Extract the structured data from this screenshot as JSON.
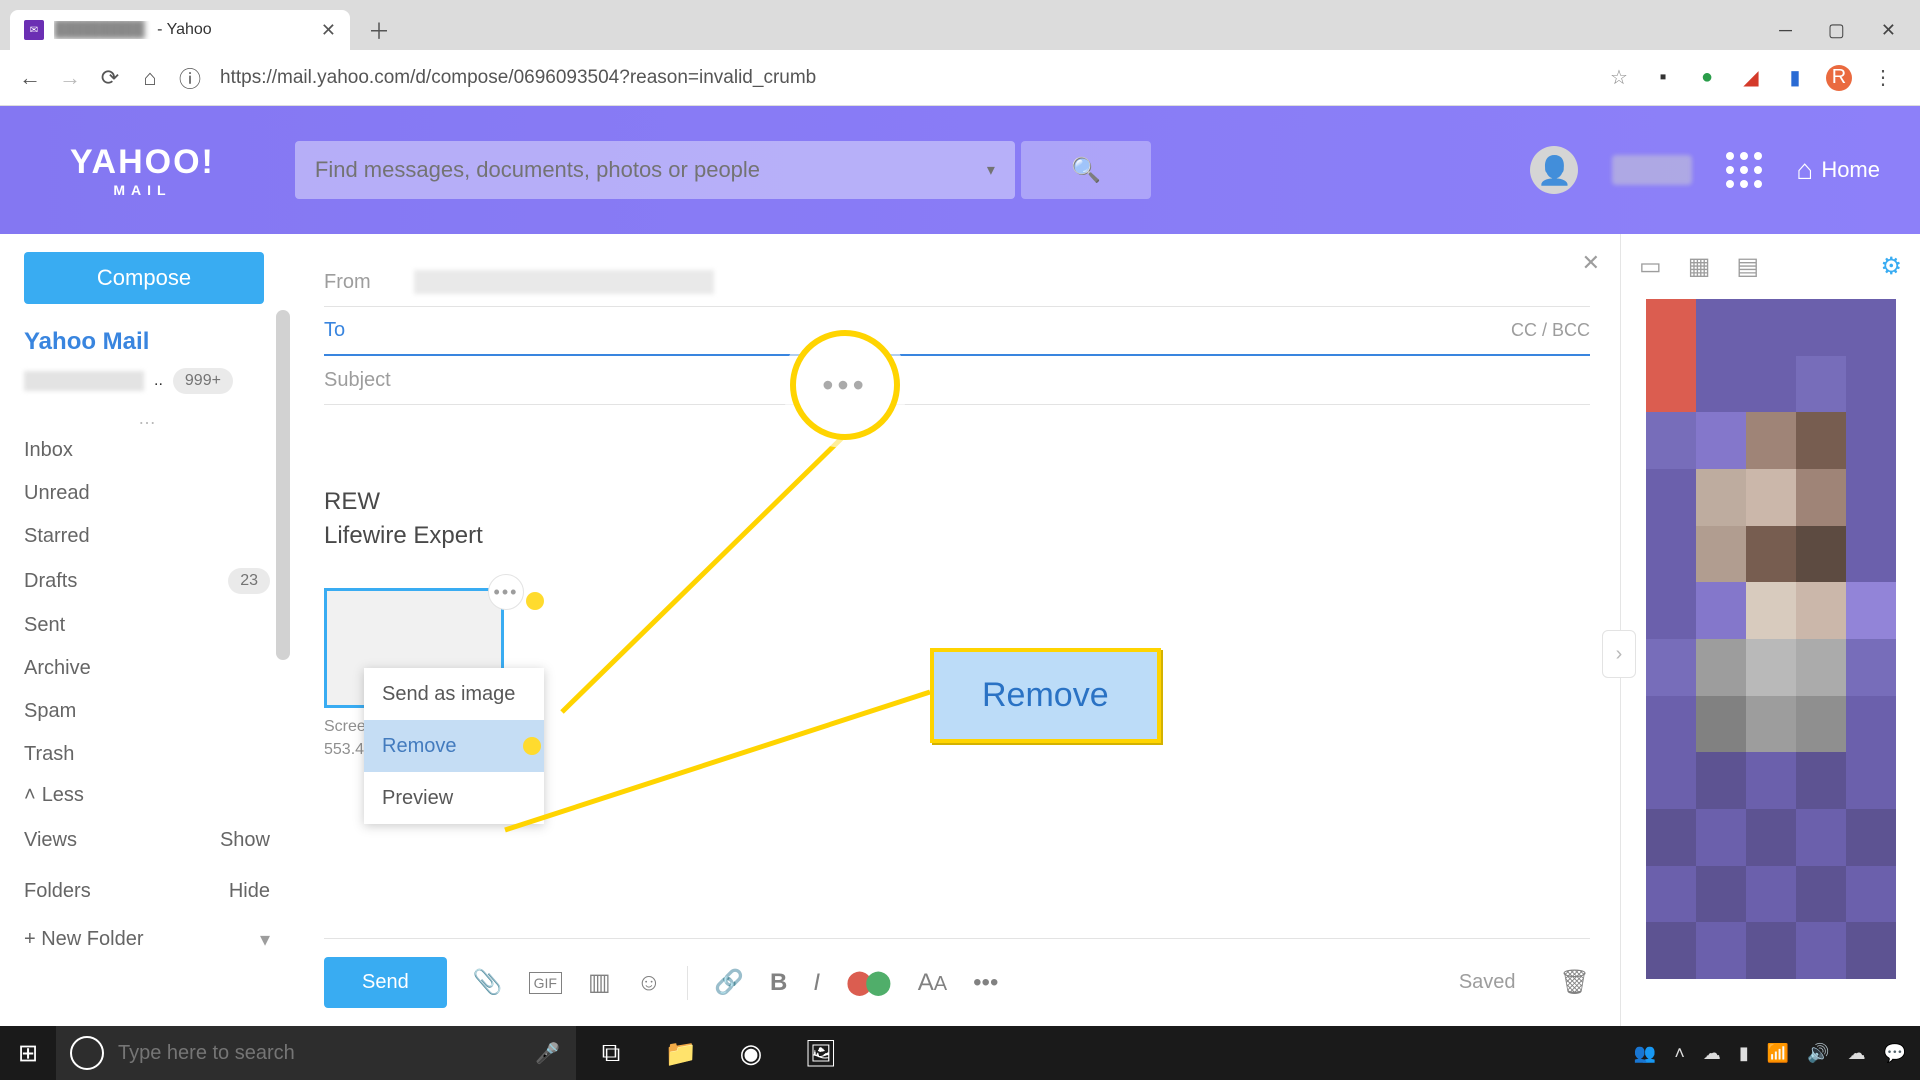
{
  "browser": {
    "tab_title_suffix": " - Yahoo",
    "url": "https://mail.yahoo.com/d/compose/0696093504?reason=invalid_crumb",
    "avatar_letter": "R"
  },
  "yahoo_header": {
    "logo_top": "YAHOO!",
    "logo_sub": "MAIL",
    "search_placeholder": "Find messages, documents, photos or people",
    "home_label": "Home"
  },
  "sidebar": {
    "compose": "Compose",
    "section_title": "Yahoo Mail",
    "unread_badge": "999+",
    "folders": [
      {
        "label": "Inbox"
      },
      {
        "label": "Unread"
      },
      {
        "label": "Starred"
      },
      {
        "label": "Drafts",
        "badge": "23"
      },
      {
        "label": "Sent"
      },
      {
        "label": "Archive"
      },
      {
        "label": "Spam"
      },
      {
        "label": "Trash"
      }
    ],
    "less": "Less",
    "views": {
      "label": "Views",
      "action": "Show"
    },
    "folders_section": {
      "label": "Folders",
      "action": "Hide"
    },
    "new_folder": "+ New Folder"
  },
  "compose": {
    "from_label": "From",
    "to_label": "To",
    "ccbcc": "CC / BCC",
    "subject_label": "Subject",
    "signature_line1": "REW",
    "signature_line2": "Lifewire Expert",
    "attachment_name": "Scree",
    "attachment_size": "553.4",
    "context_menu": {
      "send_image": "Send as image",
      "remove": "Remove",
      "preview": "Preview"
    },
    "send": "Send",
    "saved": "Saved"
  },
  "callouts": {
    "remove_big": "Remove",
    "more_dots": "•••"
  },
  "taskbar": {
    "search_placeholder": "Type here to search"
  }
}
